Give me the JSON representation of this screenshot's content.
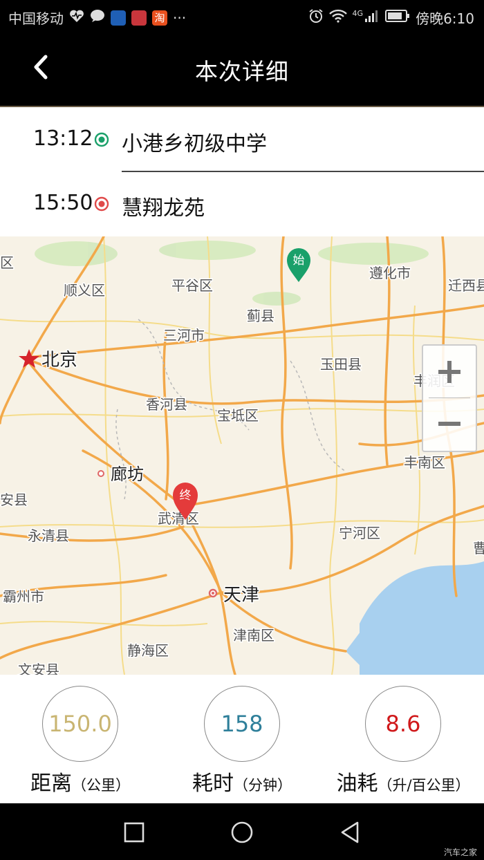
{
  "status_bar": {
    "carrier": "中国移动",
    "network": "4G",
    "time": "傍晚6:10",
    "icons": [
      "heart-pulse-icon",
      "message-icon",
      "car-app-icon",
      "news-app-icon",
      "taobao-icon",
      "more-icon",
      "alarm-icon",
      "wifi-icon",
      "signal-icon",
      "battery-icon"
    ],
    "taobao_glyph": "淘",
    "more_glyph": "···"
  },
  "header": {
    "title": "本次详细",
    "back_icon": "back-chevron-icon"
  },
  "route": {
    "start": {
      "time": "13:12",
      "place": "小港乡初级中学",
      "color": "#1aa06a"
    },
    "end": {
      "time": "15:50",
      "place": "慧翔龙苑",
      "color": "#e04a4a"
    }
  },
  "map": {
    "start_marker": "始",
    "end_marker": "终",
    "zoom_in_icon": "plus-icon",
    "zoom_out_icon": "minus-icon",
    "labels": {
      "l01": "区",
      "l02": "顺义区",
      "l03": "平谷区",
      "l04": "遵化市",
      "l05": "迁西县",
      "l06": "蓟县",
      "l07": "三河市",
      "l08": "北京",
      "l09": "玉田县",
      "l10": "丰润区",
      "l11": "香河县",
      "l12": "宝坻区",
      "l13": "廊坊",
      "l14": "丰南区",
      "l15": "安县",
      "l16": "武清区",
      "l17": "永清县",
      "l18": "宁河区",
      "l19": "曹",
      "l20": "霸州市",
      "l21": "天津",
      "l22": "津南区",
      "l23": "静海区",
      "l24": "文安县"
    }
  },
  "stats": {
    "distance": {
      "value": "150.0",
      "label": "距离",
      "unit": "（公里）",
      "color": "#c9b572"
    },
    "duration": {
      "value": "158",
      "label": "耗时",
      "unit": "（分钟）",
      "color": "#2e7f9a"
    },
    "fuel": {
      "value": "8.6",
      "label": "油耗",
      "unit": "（升/百公里）",
      "color": "#d0191b"
    }
  },
  "system_nav": {
    "back": "nav-back-icon",
    "home": "nav-home-icon",
    "recents": "nav-recents-icon"
  },
  "watermark": "汽车之家"
}
